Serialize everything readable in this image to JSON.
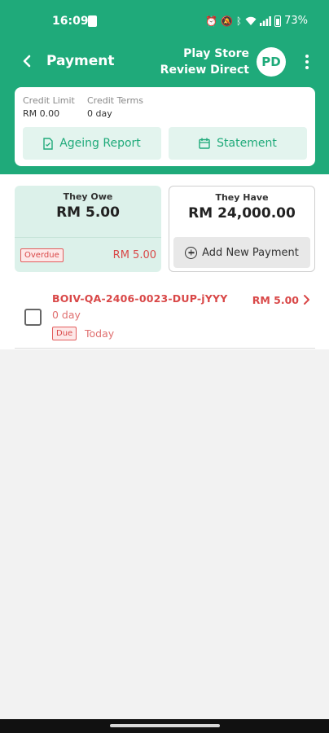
{
  "status_bar": {
    "time": "16:09",
    "battery": "73%"
  },
  "app_bar": {
    "title": "Payment",
    "account_line1": "Play Store",
    "account_line2": "Review Direct",
    "avatar_initials": "PD"
  },
  "credit": {
    "limit_label": "Credit Limit",
    "limit_value": "RM 0.00",
    "terms_label": "Credit Terms",
    "terms_value": "0 day",
    "ageing_report_label": "Ageing Report",
    "statement_label": "Statement"
  },
  "summary": {
    "owe_title": "They Owe",
    "owe_amount": "RM 5.00",
    "overdue_label": "Overdue",
    "overdue_amount": "RM 5.00",
    "have_title": "They Have",
    "have_amount": "RM 24,000.00",
    "add_payment_label": "Add New Payment"
  },
  "invoices": [
    {
      "number": "BOIV-QA-2406-0023-DUP-jYYY",
      "age": "0 day",
      "status": "Due",
      "due_date": "Today",
      "amount": "RM 5.00"
    }
  ],
  "colors": {
    "brand_green": "#1faa7a",
    "light_green": "#dcf1ea",
    "alert_red": "#d94848"
  }
}
